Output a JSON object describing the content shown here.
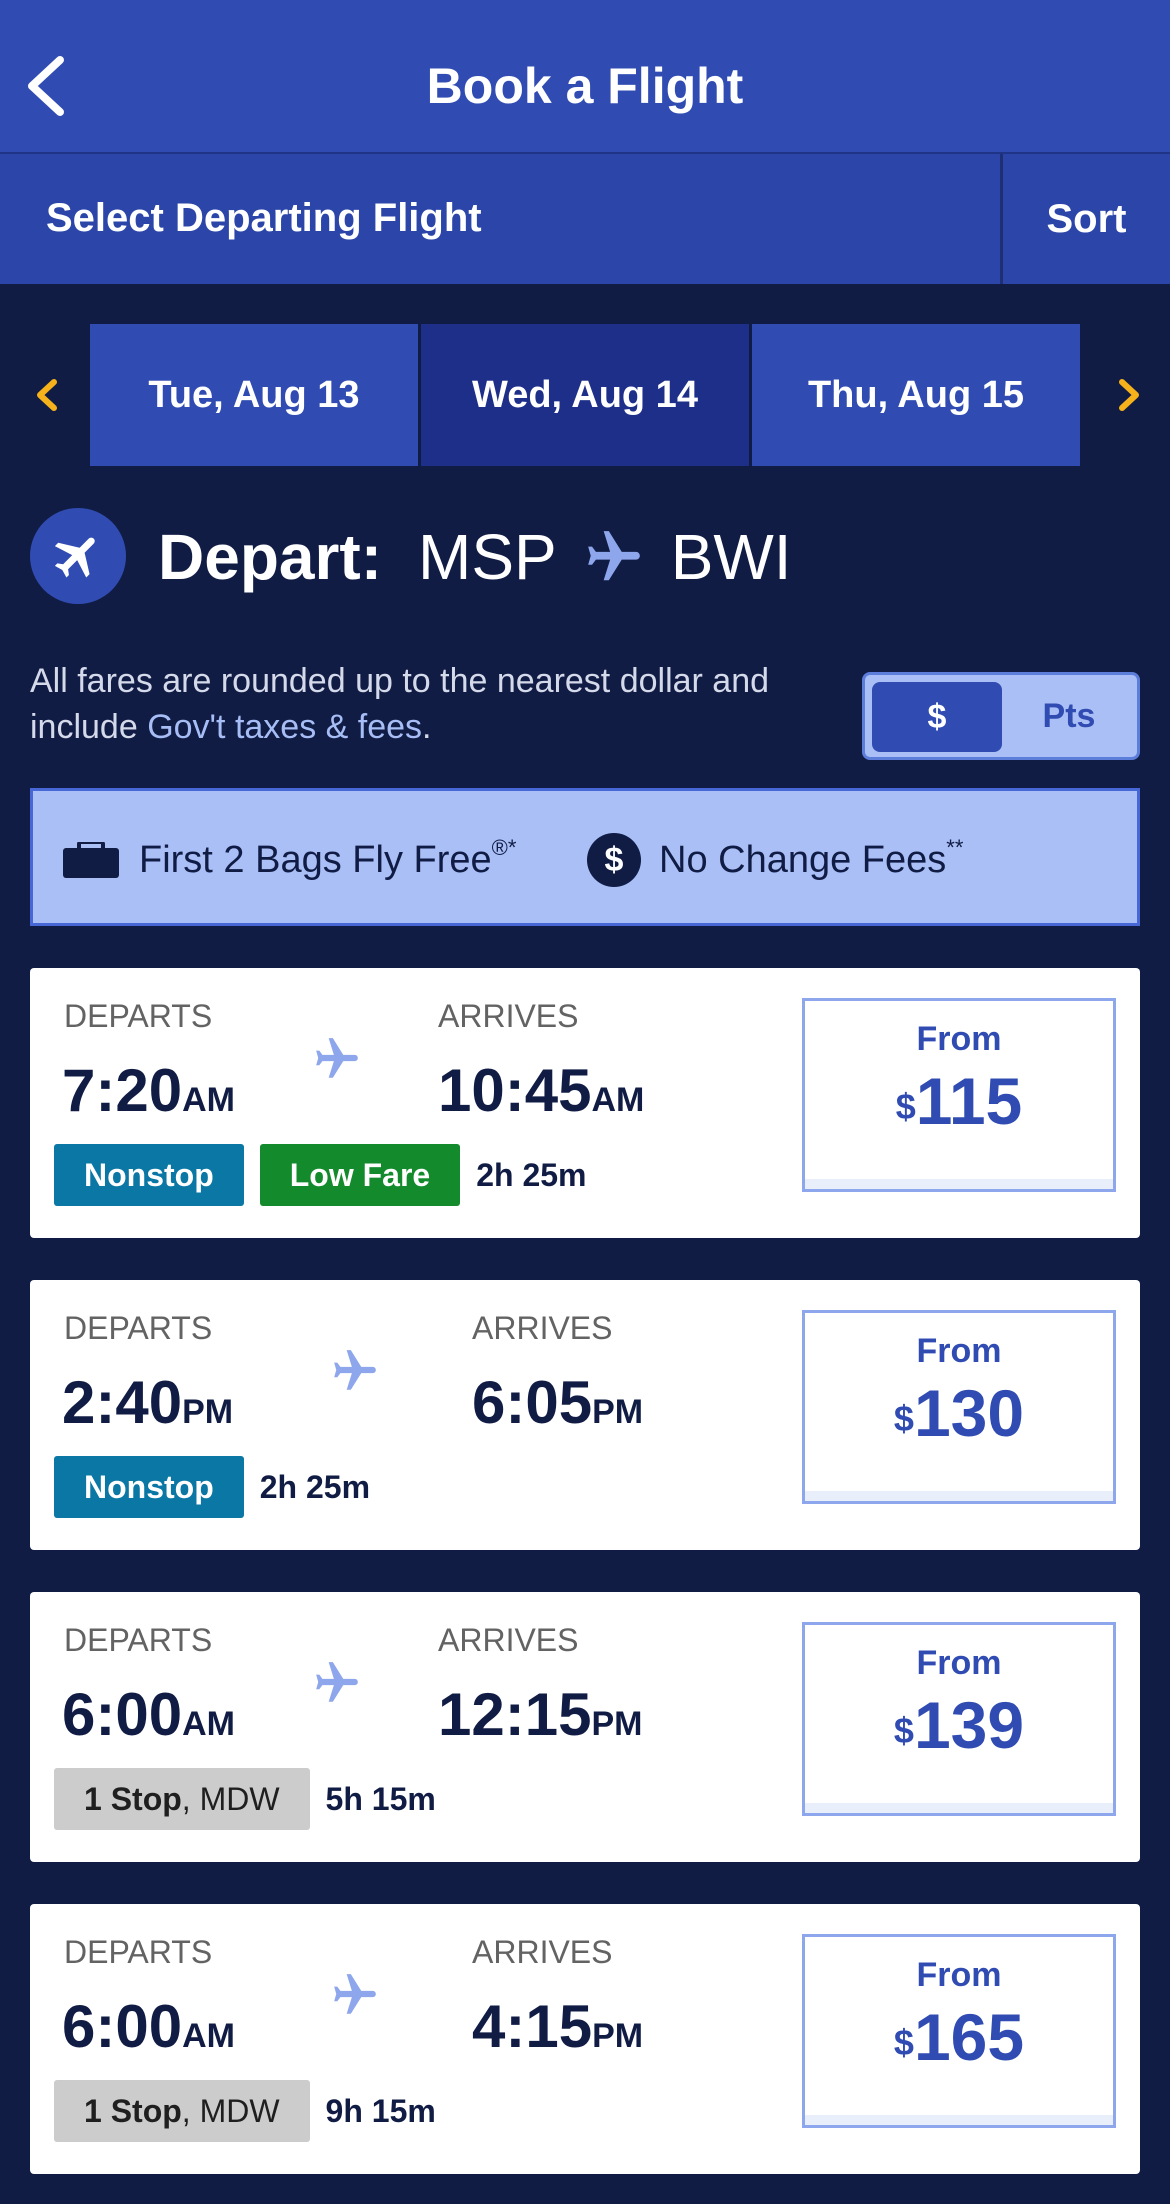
{
  "header": {
    "title": "Book a Flight"
  },
  "subheader": {
    "label": "Select Departing Flight",
    "sort_label": "Sort"
  },
  "date_tabs": [
    {
      "label": "Tue, Aug 13"
    },
    {
      "label": "Wed, Aug 14"
    },
    {
      "label": "Thu, Aug 15"
    }
  ],
  "selected_date": "Wed, Aug 14",
  "depart": {
    "label": "Depart:",
    "origin": "MSP",
    "destination": "BWI"
  },
  "fare_note": {
    "text": "All fares are rounded up to the nearest dollar and include ",
    "link": "Gov't taxes & fees",
    "end": "."
  },
  "currency_toggle": {
    "dollar": "$",
    "points": "Pts",
    "selected": "$"
  },
  "perks": {
    "bags": {
      "text": "First 2 Bags Fly Free",
      "mark": "®*",
      "icon": "suitcase-icon"
    },
    "fees": {
      "text": "No Change Fees",
      "mark": "**",
      "icon": "dollar-coin-icon"
    }
  },
  "flights": [
    {
      "departs_label": "DEPARTS",
      "arrives_label": "ARRIVES",
      "dep_time": "7:20",
      "dep_ampm": "AM",
      "arr_time": "10:45",
      "arr_ampm": "AM",
      "tag1": "Nonstop",
      "tag2": "Low Fare",
      "duration": "2h 25m",
      "from_label": "From",
      "currency": "$",
      "price": "115"
    },
    {
      "departs_label": "DEPARTS",
      "arrives_label": "ARRIVES",
      "dep_time": "2:40",
      "dep_ampm": "PM",
      "arr_time": "6:05",
      "arr_ampm": "PM",
      "tag1": "Nonstop",
      "duration": "2h 25m",
      "from_label": "From",
      "currency": "$",
      "price": "130"
    },
    {
      "departs_label": "DEPARTS",
      "arrives_label": "ARRIVES",
      "dep_time": "6:00",
      "dep_ampm": "AM",
      "arr_time": "12:15",
      "arr_ampm": "PM",
      "stop_bold": "1 Stop",
      "stop_rest": ", MDW",
      "duration": "5h 15m",
      "from_label": "From",
      "currency": "$",
      "price": "139"
    },
    {
      "departs_label": "DEPARTS",
      "arrives_label": "ARRIVES",
      "dep_time": "6:00",
      "dep_ampm": "AM",
      "arr_time": "4:15",
      "arr_ampm": "PM",
      "stop_bold": "1 Stop",
      "stop_rest": ", MDW",
      "duration": "9h 15m",
      "from_label": "From",
      "currency": "$",
      "price": "165"
    }
  ],
  "colors": {
    "brand": "#304cb2",
    "navy": "#111c45",
    "nonstop": "#0a77a5",
    "low_fare": "#138a2b",
    "accent": "#f5b21b"
  }
}
